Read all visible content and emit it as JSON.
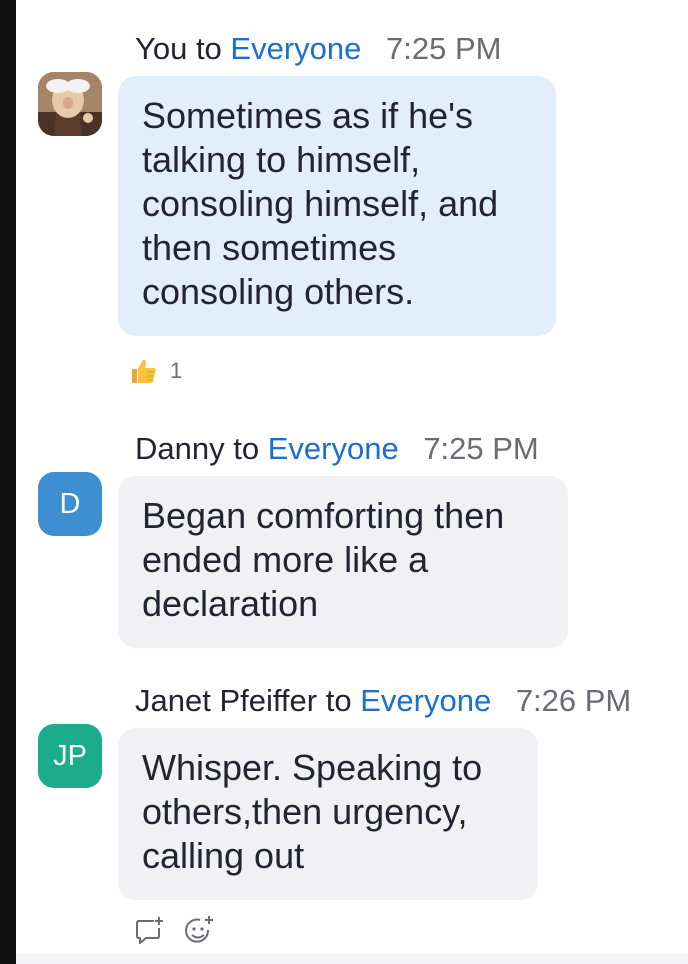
{
  "messages": [
    {
      "sender": "You",
      "connector": "to",
      "recipient": "Everyone",
      "time": "7:25 PM",
      "text": "Sometimes as if he's talking to himself, consoling himself, and then sometimes consoling others.",
      "avatar_icon": "photo-avatar",
      "reaction": {
        "icon": "thumbs-up-icon",
        "count": "1"
      }
    },
    {
      "sender": "Danny",
      "connector": "to",
      "recipient": "Everyone",
      "time": "7:25 PM",
      "text": "Began comforting then ended more like a declaration",
      "avatar_initials": "D",
      "avatar_color": "#3d8fd2"
    },
    {
      "sender": "Janet Pfeiffer",
      "connector": "to",
      "recipient": "Everyone",
      "time": "7:26 PM",
      "text": "Whisper. Speaking to others,then urgency, calling out",
      "avatar_initials": "JP",
      "avatar_color": "#1bac8c"
    }
  ],
  "actions": [
    {
      "icon": "reply-icon"
    },
    {
      "icon": "add-reaction-icon"
    }
  ],
  "colors": {
    "recipient_link": "#1a6fd0",
    "own_bubble": "#e2eefc",
    "other_bubble": "#f1f1f5"
  }
}
